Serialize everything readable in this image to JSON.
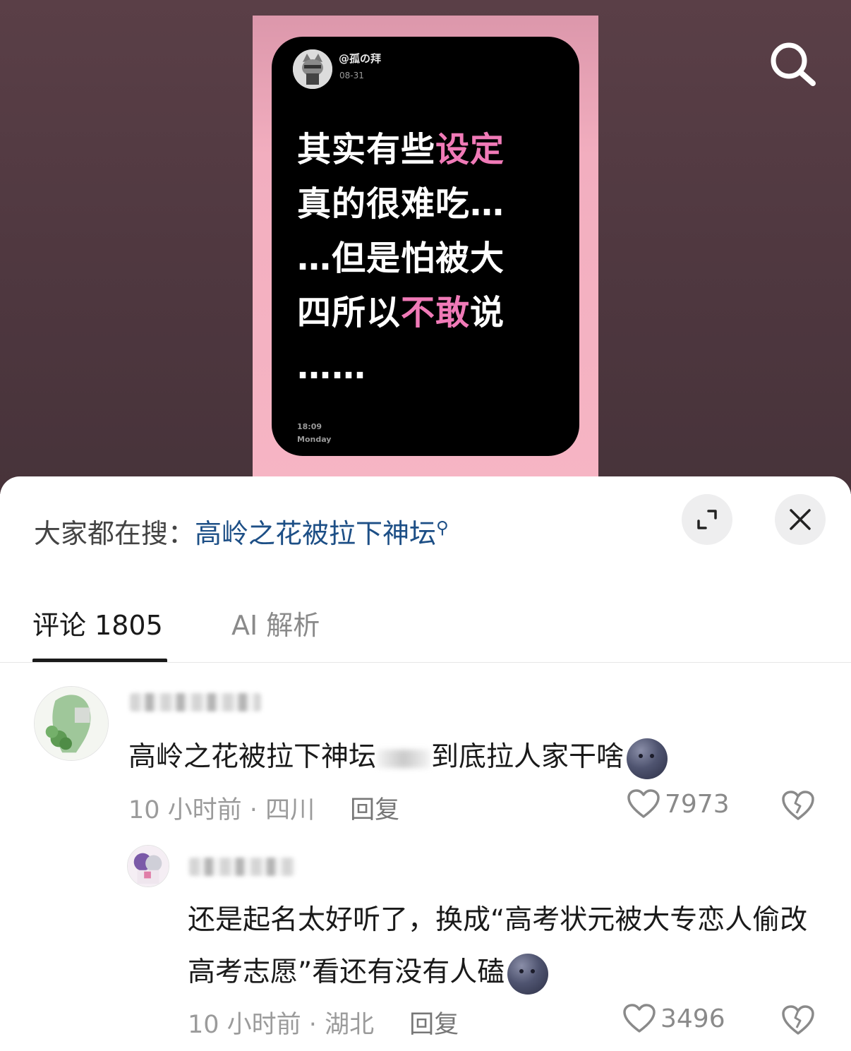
{
  "video": {
    "poster_user": "@孤の拜",
    "poster_date": "08-31",
    "poster_lines": [
      [
        {
          "t": "其实有些",
          "pink": false
        },
        {
          "t": "设定",
          "pink": true
        }
      ],
      [
        {
          "t": "真的很难吃…",
          "pink": false
        }
      ],
      [
        {
          "t": "…但是怕被大",
          "pink": false
        }
      ],
      [
        {
          "t": "四所以",
          "pink": false
        },
        {
          "t": "不敢",
          "pink": true
        },
        {
          "t": "说",
          "pink": false
        }
      ],
      [
        {
          "t": "……",
          "pink": false
        }
      ]
    ],
    "poster_time": "18:09",
    "poster_day": "Monday",
    "search_icon": "search-icon"
  },
  "sheet": {
    "suggest_prefix": "大家都在搜：",
    "suggest_link": "高岭之花被拉下神坛",
    "expand_icon": "expand-icon",
    "close_icon": "close-icon"
  },
  "tabs": {
    "comments_label": "评论 1805",
    "ai_label": "AI 解析"
  },
  "comments": [
    {
      "text_before": "高岭之花被拉下神坛",
      "text_after": "到底拉人家干啥",
      "time": "10 小时前",
      "location": "四川",
      "reply": "回复",
      "likes": "7973"
    },
    {
      "text": "还是起名太好听了，换成“高考状元被大专恋人偷改高考志愿”看还有没有人磕",
      "time": "10 小时前",
      "location": "湖北",
      "reply": "回复",
      "likes": "3496"
    }
  ],
  "colors": {
    "accent_pink": "#f07ab7",
    "link_blue": "#1d4f86"
  }
}
